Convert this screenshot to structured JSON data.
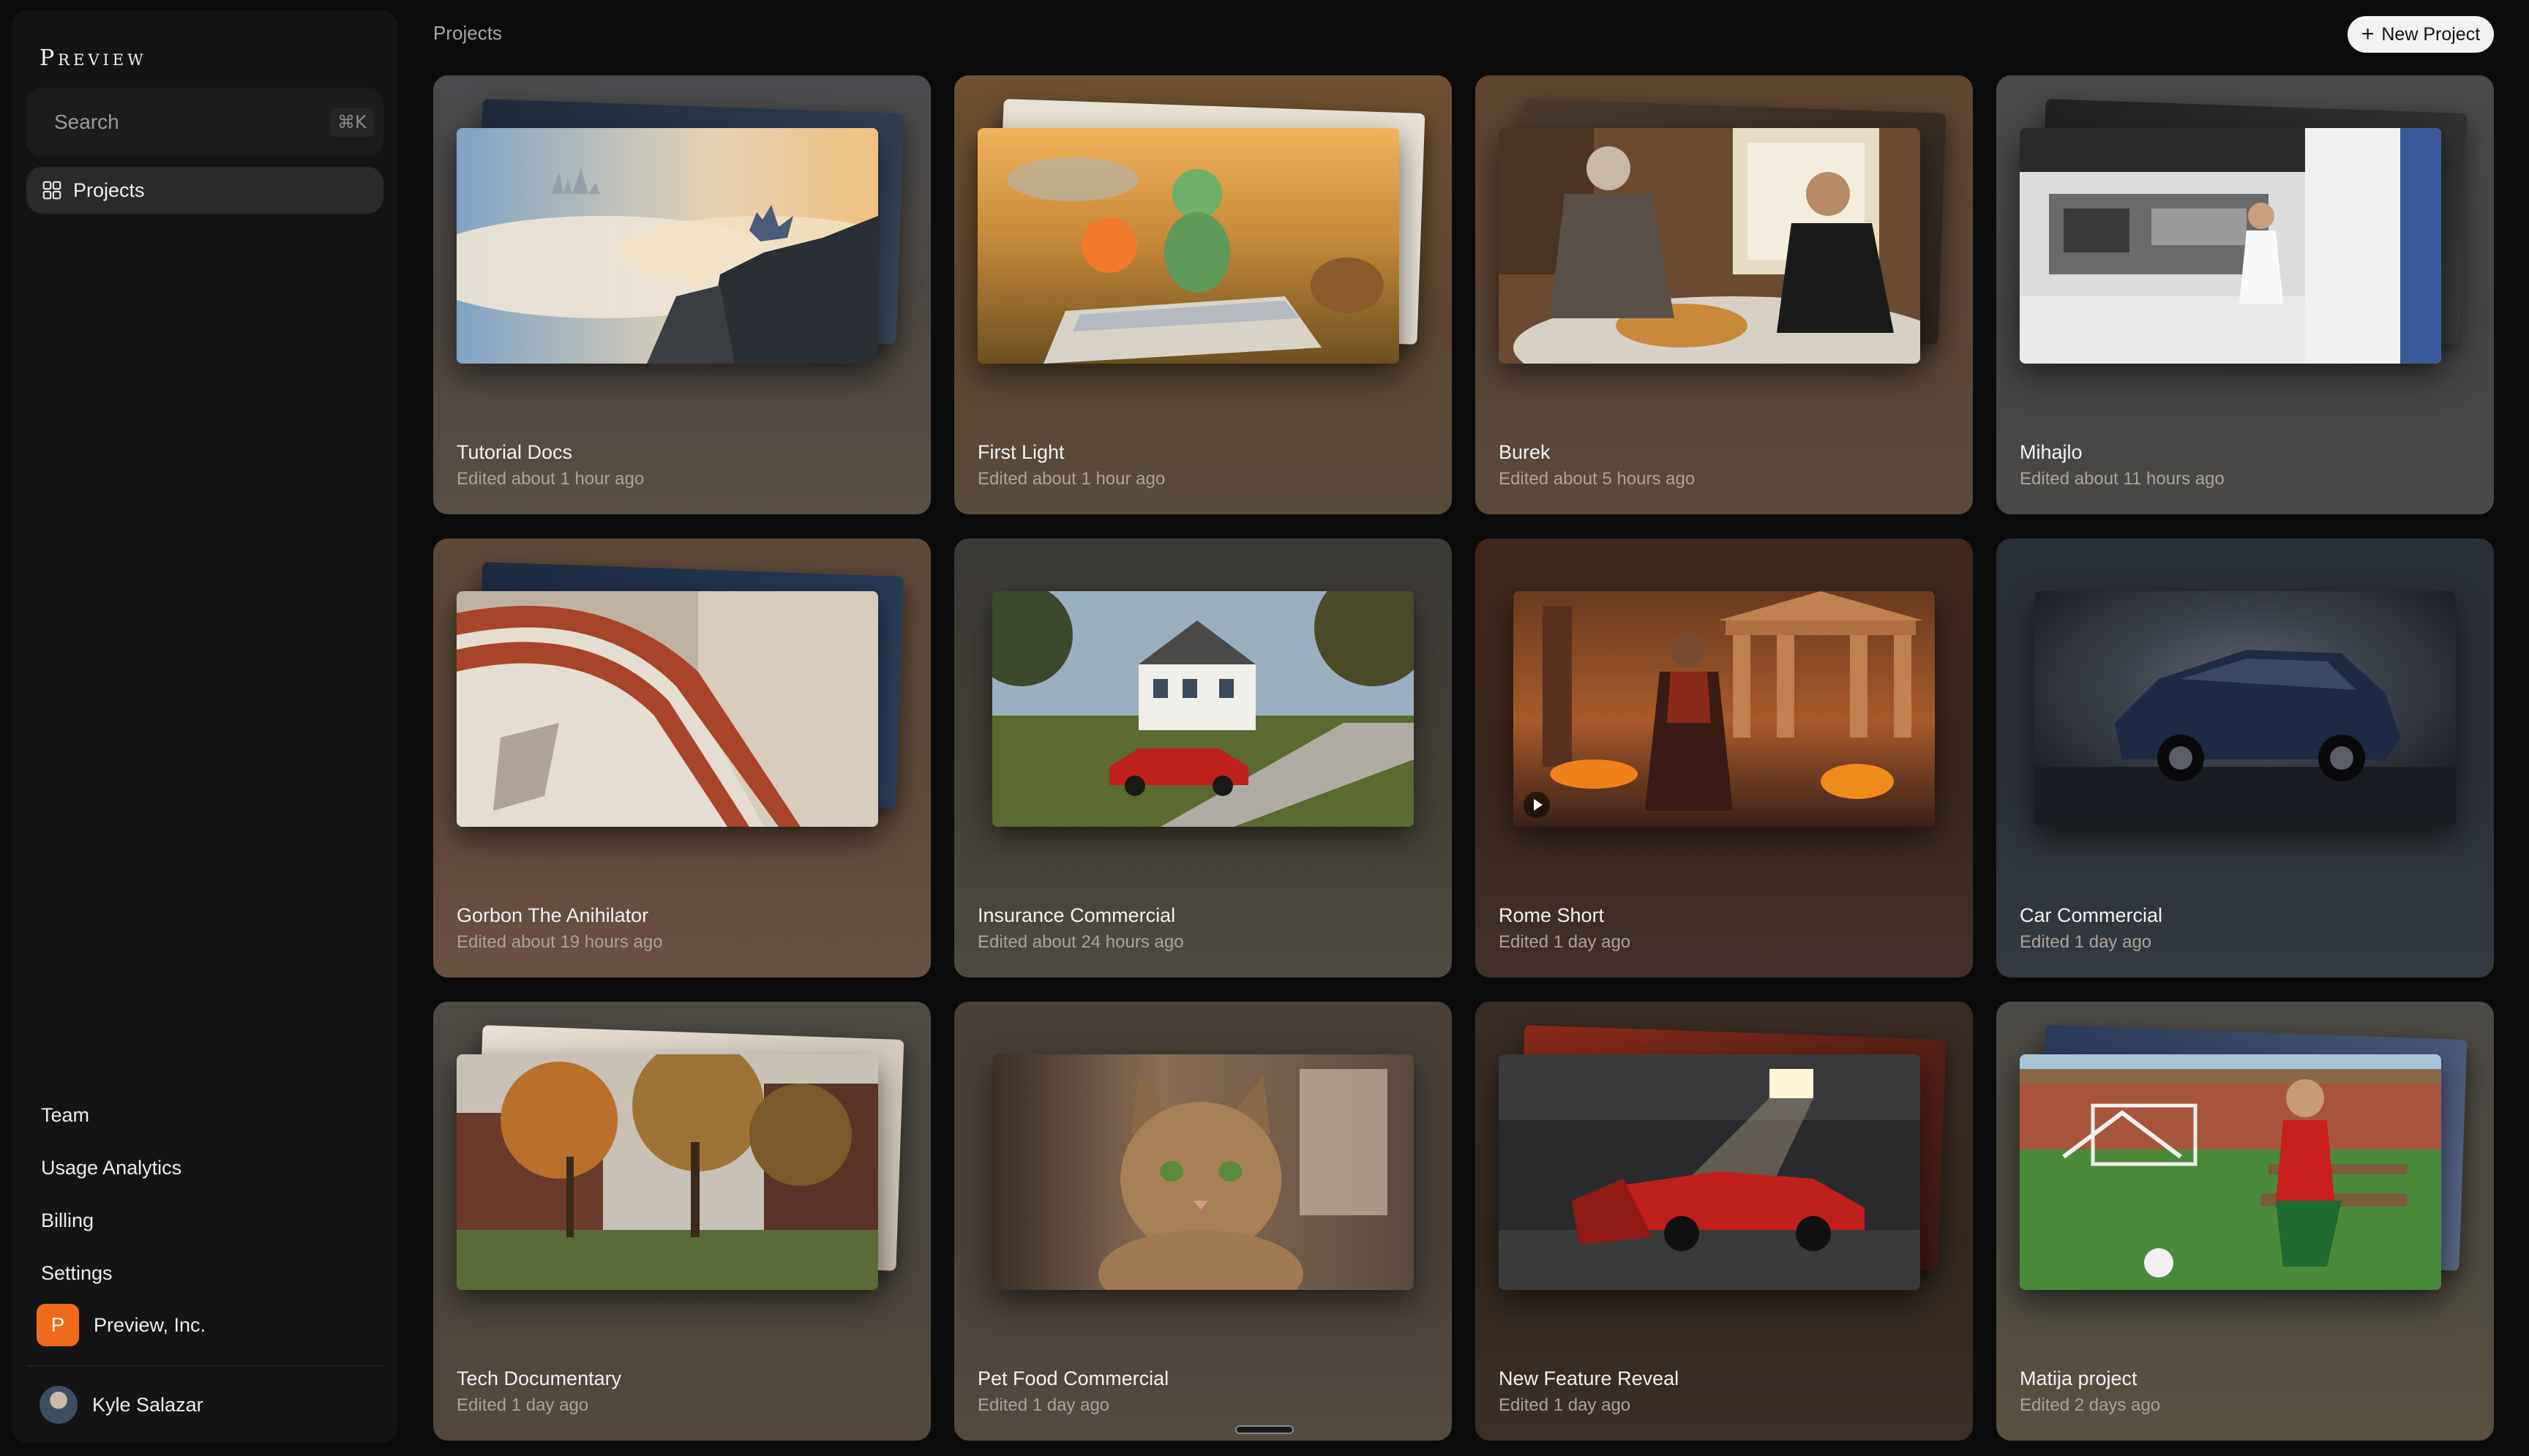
{
  "app": {
    "logo": "Preview"
  },
  "sidebar": {
    "search_placeholder": "Search",
    "search_shortcut": "⌘K",
    "nav_active": "Projects",
    "bottom_items": [
      "Team",
      "Usage Analytics",
      "Billing",
      "Settings"
    ],
    "org": {
      "initial": "P",
      "name": "Preview, Inc.",
      "color": "#f26a1b"
    },
    "user": {
      "name": "Kyle Salazar"
    }
  },
  "header": {
    "breadcrumb": "Projects",
    "new_project_label": "New Project"
  },
  "projects": [
    {
      "title": "Tutorial Docs",
      "edited": "Edited about 1 hour ago"
    },
    {
      "title": "First Light",
      "edited": "Edited about 1 hour ago"
    },
    {
      "title": "Burek",
      "edited": "Edited about 5 hours ago"
    },
    {
      "title": "Mihajlo",
      "edited": "Edited about 11 hours ago"
    },
    {
      "title": "Gorbon The Anihilator",
      "edited": "Edited about 19 hours ago"
    },
    {
      "title": "Insurance Commercial",
      "edited": "Edited about 24 hours ago"
    },
    {
      "title": "Rome Short",
      "edited": "Edited 1 day ago",
      "has_video": true
    },
    {
      "title": "Car Commercial",
      "edited": "Edited 1 day ago"
    },
    {
      "title": "Tech Documentary",
      "edited": "Edited 1 day ago"
    },
    {
      "title": "Pet Food Commercial",
      "edited": "Edited 1 day ago"
    },
    {
      "title": "New Feature Reveal",
      "edited": "Edited 1 day ago"
    },
    {
      "title": "Matija project",
      "edited": "Edited 2 days ago"
    }
  ]
}
